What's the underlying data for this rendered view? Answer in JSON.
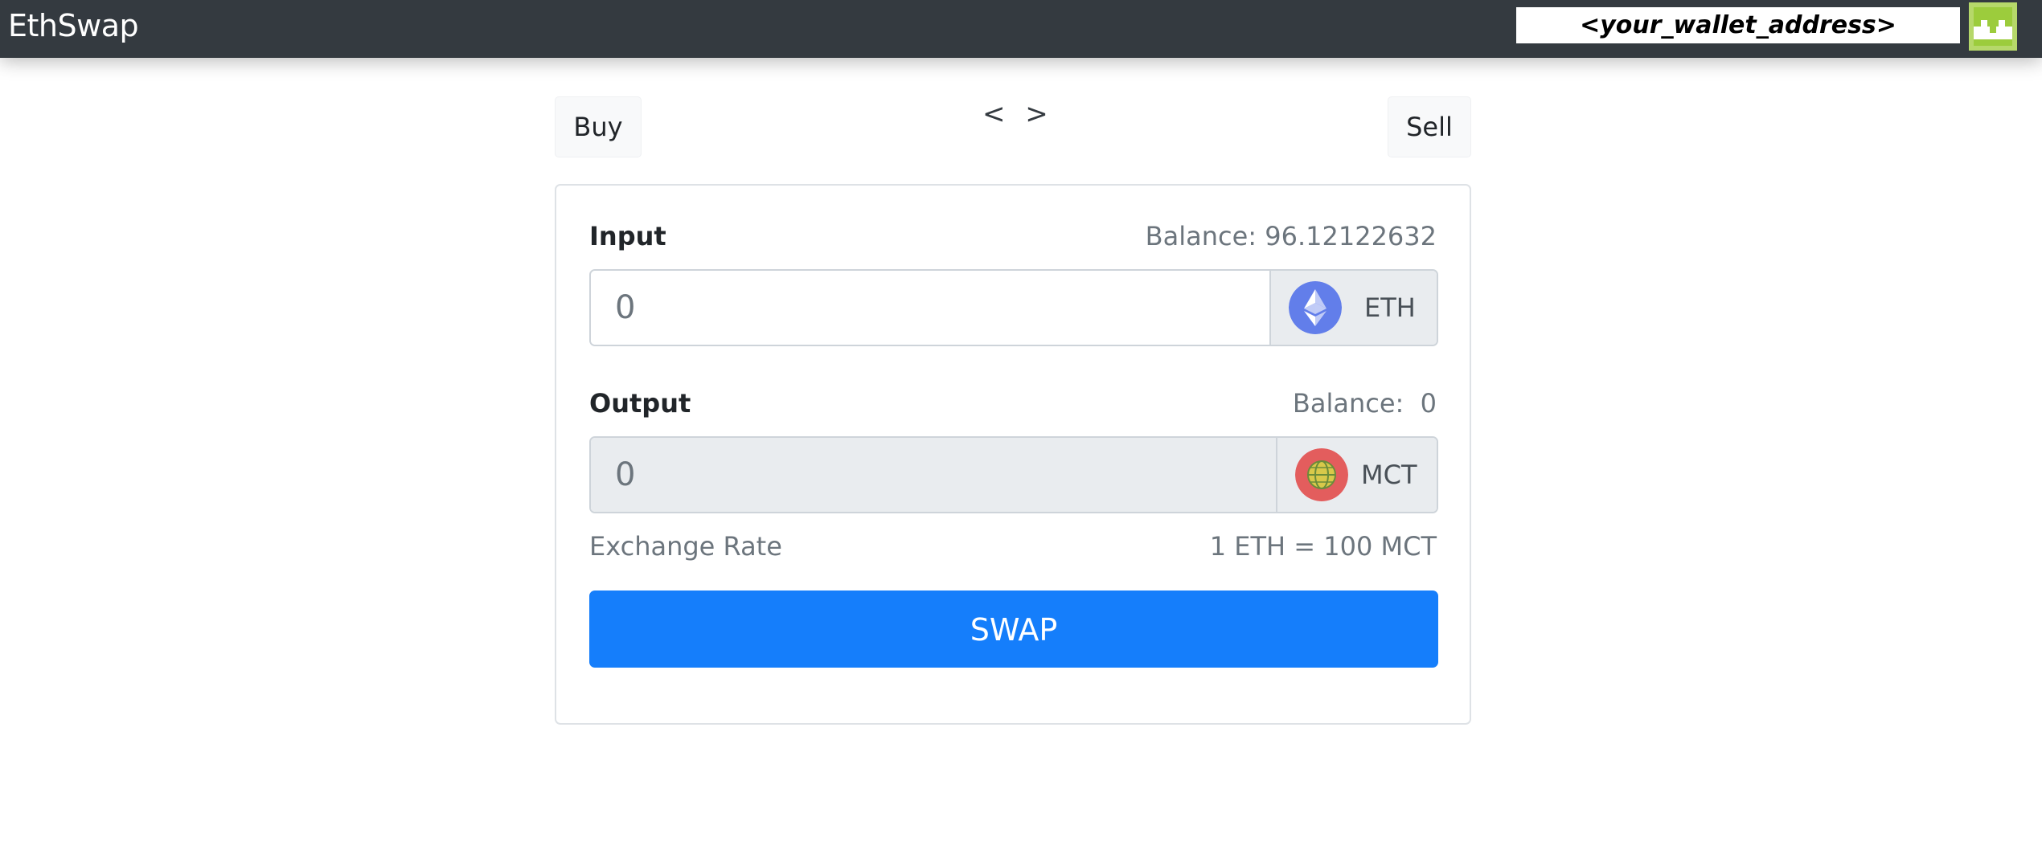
{
  "navbar": {
    "brand": "EthSwap",
    "wallet_address": "<your_wallet_address>",
    "avatar_icon": "identicon-avatar"
  },
  "mode_toggle": {
    "buy_label": "Buy",
    "sell_label": "Sell",
    "arrows": "<  >"
  },
  "form": {
    "input": {
      "label": "Input",
      "balance_text": "Balance: 96.12122632",
      "placeholder": "0",
      "token": "ETH",
      "token_icon": "ethereum-icon"
    },
    "output": {
      "label": "Output",
      "balance_text": "Balance:  0",
      "placeholder": "0",
      "token": "MCT",
      "token_icon": "globe-token-icon"
    },
    "exchange_rate": {
      "label": "Exchange Rate",
      "value": "1 ETH = 100 MCT"
    },
    "submit_label": "SWAP"
  },
  "colors": {
    "navbar_bg": "#343a40",
    "primary": "#157efb",
    "eth_icon": "#627eea",
    "mct_icon": "#e35d5d",
    "avatar": "#b6d86a"
  }
}
